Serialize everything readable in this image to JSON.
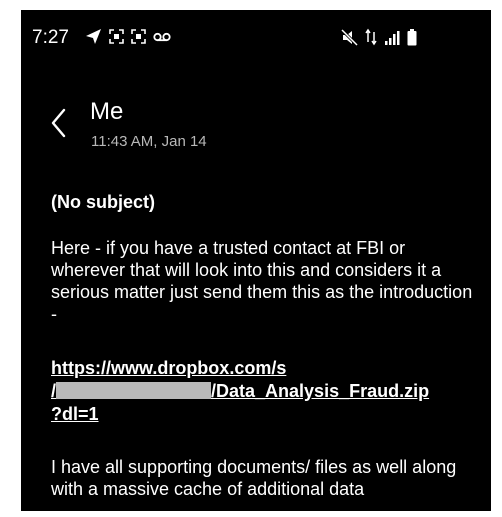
{
  "status_bar": {
    "time": "7:27"
  },
  "header": {
    "sender": "Me",
    "timestamp": "11:43 AM, Jan 14"
  },
  "message": {
    "subject": "(No subject)",
    "paragraph1": "Here - if you have a trusted contact at FBI or wherever that will look into this and considers it a serious matter just send them this as the introduction  -",
    "link_line1": "https://www.dropbox.com/s",
    "link_prefix": "/",
    "link_suffix": "/Data_Analysis_Fraud.zip",
    "link_line3": "?dl=1",
    "paragraph2": "I have all supporting documents/ files as well along with a massive cache of additional data"
  },
  "icons": {
    "status_left": [
      "navigation-arrow-icon",
      "screenshot-icon",
      "screenshot-icon",
      "voicemail-icon"
    ],
    "status_right": [
      "mute-icon",
      "data-transfer-icon",
      "signal-icon",
      "battery-icon"
    ]
  }
}
